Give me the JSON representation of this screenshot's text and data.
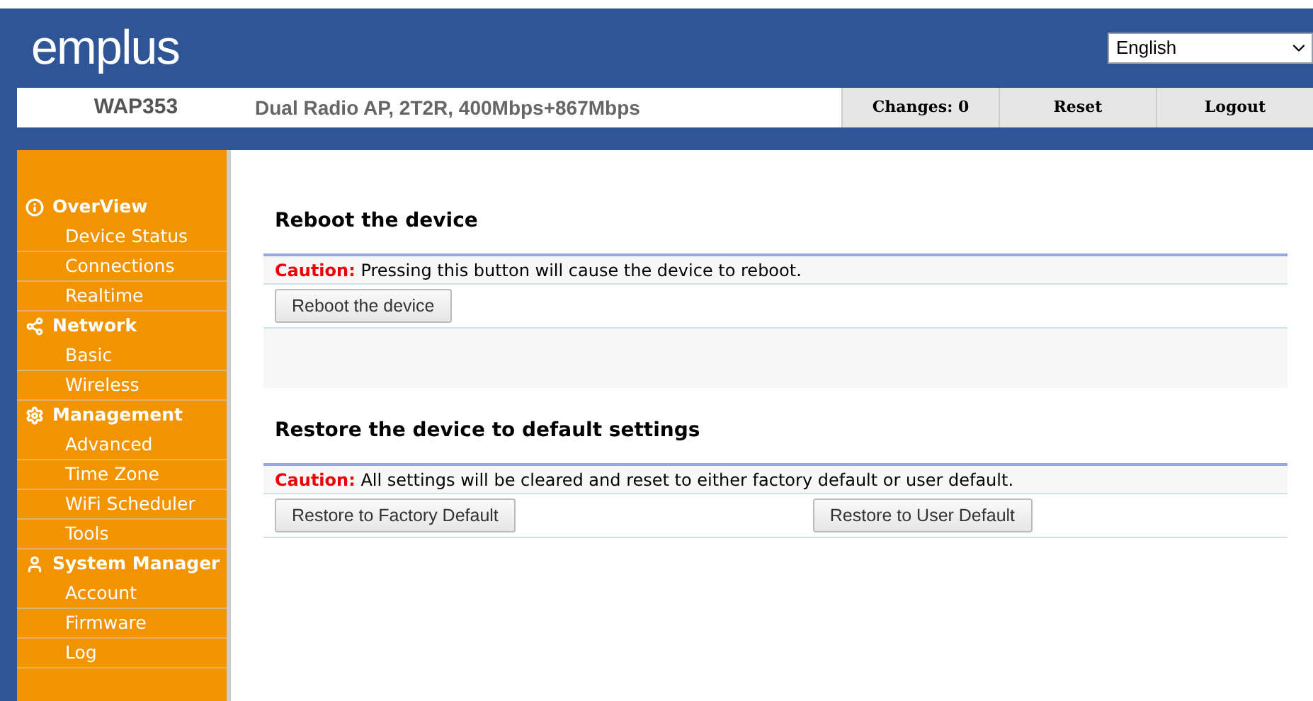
{
  "header": {
    "logo": "emplus",
    "language": "English"
  },
  "topbar": {
    "model": "WAP353",
    "description": "Dual Radio AP, 2T2R, 400Mbps+867Mbps",
    "buttons": [
      "Changes: 0",
      "Reset",
      "Logout"
    ]
  },
  "sidebar": {
    "groups": [
      {
        "title": "OverView",
        "items": [
          "Device Status",
          "Connections",
          "Realtime"
        ]
      },
      {
        "title": "Network",
        "items": [
          "Basic",
          "Wireless"
        ]
      },
      {
        "title": "Management",
        "items": [
          "Advanced",
          "Time Zone",
          "WiFi Scheduler",
          "Tools"
        ]
      },
      {
        "title": "System Manager",
        "items": [
          "Account",
          "Firmware",
          "Log"
        ]
      }
    ]
  },
  "sections": [
    {
      "title": "Reboot the device",
      "caution_label": "Caution:",
      "caution": "Pressing this button will cause the device to reboot.",
      "buttons": [
        "Reboot the device"
      ]
    },
    {
      "title": "Restore the device to default settings",
      "caution_label": "Caution:",
      "caution": "All settings will be cleared and reset to either factory default or user default.",
      "buttons": [
        "Restore to Factory Default",
        "Restore to User Default"
      ]
    }
  ]
}
